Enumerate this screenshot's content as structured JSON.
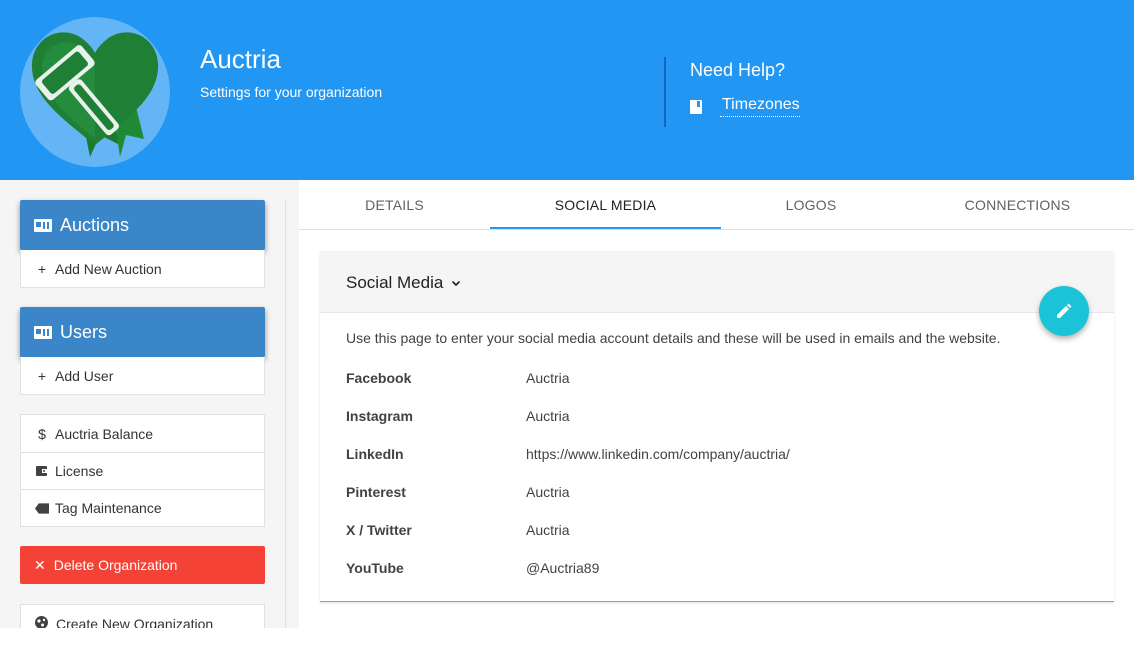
{
  "header": {
    "org_name": "Auctria",
    "org_subtitle": "Settings for your organization",
    "help_title": "Need Help?",
    "help_link": "Timezones"
  },
  "sidebar": {
    "auctions_label": "Auctions",
    "add_auction_label": "Add New Auction",
    "users_label": "Users",
    "add_user_label": "Add User",
    "balance_icon": "$",
    "balance_label": "Auctria Balance",
    "license_label": "License",
    "tag_label": "Tag Maintenance",
    "delete_label": "Delete Organization",
    "create_label": "Create New Organization"
  },
  "tabs": [
    {
      "label": "DETAILS"
    },
    {
      "label": "SOCIAL MEDIA"
    },
    {
      "label": "LOGOS"
    },
    {
      "label": "CONNECTIONS"
    }
  ],
  "active_tab": "SOCIAL MEDIA",
  "panel": {
    "title": "Social Media",
    "description": "Use this page to enter your social media account details and these will be used in emails and the website.",
    "fields": [
      {
        "label": "Facebook",
        "value": "Auctria"
      },
      {
        "label": "Instagram",
        "value": "Auctria"
      },
      {
        "label": "LinkedIn",
        "value": "https://www.linkedin.com/company/auctria/"
      },
      {
        "label": "Pinterest",
        "value": "Auctria"
      },
      {
        "label": "X / Twitter",
        "value": "Auctria"
      },
      {
        "label": "YouTube",
        "value": "@Auctria89"
      }
    ]
  },
  "colors": {
    "header_bg": "#2196f3",
    "sidebar_button": "#3a86c8",
    "delete_button": "#f44336",
    "fab": "#1cc3d6",
    "tab_indicator": "#2196f3"
  },
  "icons": [
    "auctria-logo-icon",
    "book-icon",
    "id-card-icon",
    "plus-icon",
    "dollar-icon",
    "wallet-icon",
    "tag-icon",
    "close-icon",
    "globe-icon",
    "chevron-down-icon",
    "pencil-icon"
  ]
}
